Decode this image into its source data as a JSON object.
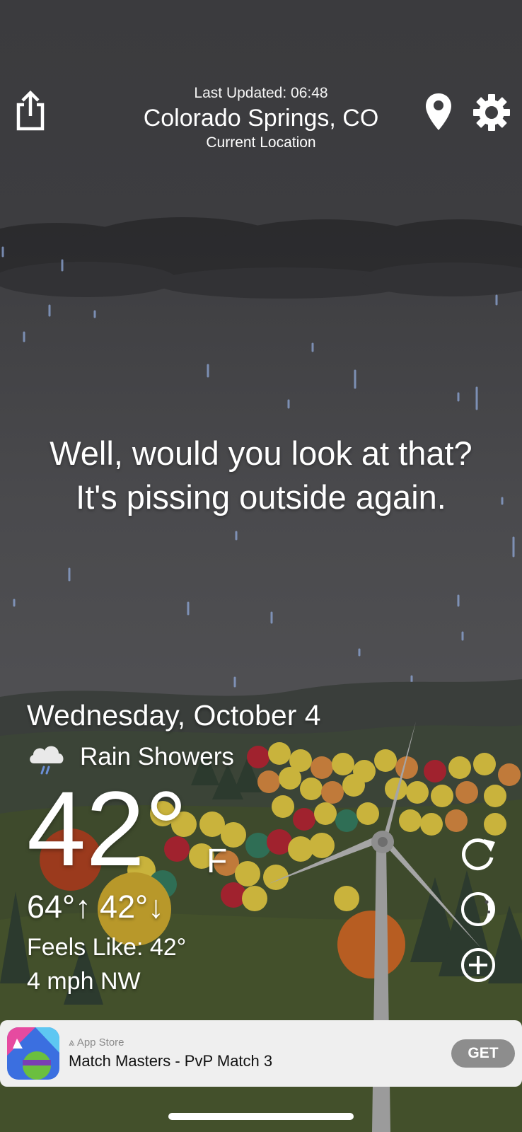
{
  "header": {
    "last_updated": "Last Updated: 06:48",
    "city": "Colorado Springs, CO",
    "location_label": "Current Location",
    "share_icon": "share-icon",
    "pin_icon": "location-pin-icon",
    "settings_icon": "gear-icon"
  },
  "quip": {
    "line1": "Well, would you look at that?",
    "line2": "It's pissing outside again."
  },
  "weather": {
    "date": "Wednesday, October 4",
    "condition": "Rain Showers",
    "condition_icon": "rain-cloud-icon",
    "temperature": "42°",
    "unit": "F",
    "high_low": "64°↑ 42°↓",
    "feels_like": "Feels Like: 42°",
    "wind": "4 mph NW"
  },
  "side_buttons": {
    "refresh_icon": "refresh-icon",
    "theme_icon": "moon-icon",
    "add_icon": "plus-circle-icon"
  },
  "ad": {
    "store_label": "App Store",
    "title": "Match Masters - PvP Match 3",
    "get_label": "GET"
  },
  "colors": {
    "sky": "#3d3d40",
    "cloud": "#2a2a2c",
    "rain": "#8fa8d8",
    "grass": "#3f4a2a",
    "ad_bg": "#efefef",
    "get_button": "#8d8d8d"
  }
}
